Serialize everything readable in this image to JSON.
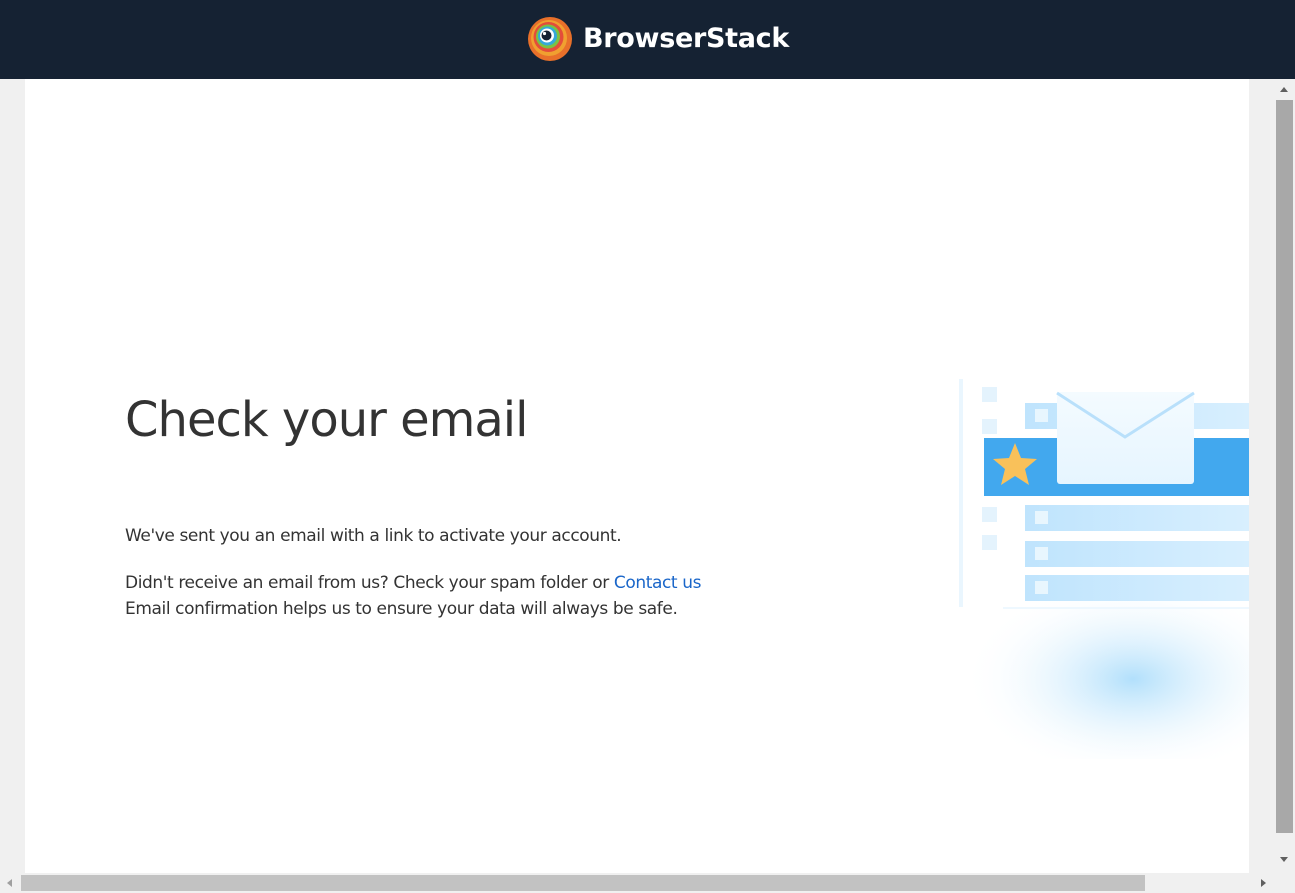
{
  "header": {
    "brand_name": "BrowserStack",
    "logo_icon": "browserstack-logo-icon",
    "background_color": "#152233"
  },
  "main": {
    "heading": "Check your email",
    "sent_message": "We've sent you an email with a link to activate your account.",
    "spam_prefix": "Didn't receive an email from us? Check your spam folder or ",
    "contact_link": "Contact us",
    "safety_message": "Email confirmation helps us to ensure your data will always be safe.",
    "illustration_icon": "email-inbox-illustration",
    "link_color": "#1a66c9",
    "text_color": "#333333"
  },
  "scrollbars": {
    "vertical": "vertical-scrollbar",
    "horizontal": "horizontal-scrollbar"
  }
}
